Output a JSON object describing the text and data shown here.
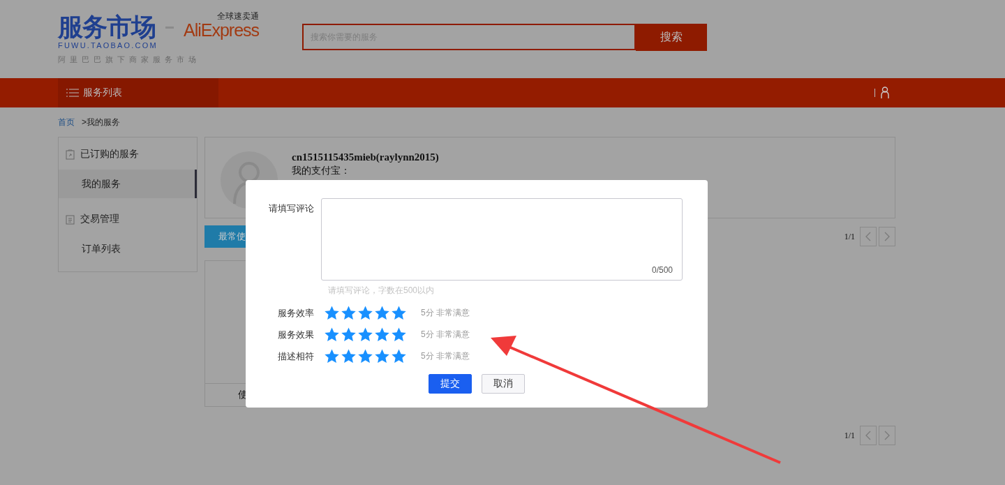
{
  "header": {
    "logo": {
      "title": "服务市场",
      "domain": "FUWU.TAOBAO.COM",
      "tagline": "阿里巴巴旗下商家服务市场",
      "partner": "AliExpress",
      "partner_subtitle": "全球速卖通"
    },
    "search": {
      "placeholder": "搜索你需要的服务",
      "button": "搜索"
    }
  },
  "nav": {
    "menu_label": "服务列表"
  },
  "breadcrumb": [
    {
      "label": "首页",
      "kind": "link"
    },
    {
      "label": ">我的服务",
      "kind": "current"
    }
  ],
  "sidebar": [
    {
      "label": "已订购的服务",
      "kind": "heading",
      "selected": false
    },
    {
      "label": "我的服务",
      "kind": "item",
      "selected": true
    },
    {
      "label": "交易管理",
      "kind": "heading",
      "selected": false
    },
    {
      "label": "订单列表",
      "kind": "item",
      "selected": false
    }
  ],
  "profile": {
    "name": "cn1515115435mieb(raylynn2015)",
    "alipay_label": "我的支付宝："
  },
  "tabs": [
    {
      "label": "最常使",
      "selected": true
    }
  ],
  "pagination": [
    {
      "page": "1/1"
    },
    {
      "page": "1/1"
    }
  ],
  "table_footer": "使",
  "dialog": {
    "comment": {
      "label": "请填写评论",
      "counter": "0/500",
      "hint": "请填写评论，字数在500以内"
    },
    "ratings": [
      {
        "label": "服务效率",
        "stars": 5,
        "reading": "5分 非常满意"
      },
      {
        "label": "服务效果",
        "stars": 5,
        "reading": "5分 非常满意"
      },
      {
        "label": "描述相符",
        "stars": 5,
        "reading": "5分 非常满意"
      }
    ],
    "buttons": [
      {
        "label": "提交",
        "kind": "primary"
      },
      {
        "label": "取消",
        "kind": "secondary"
      }
    ]
  }
}
